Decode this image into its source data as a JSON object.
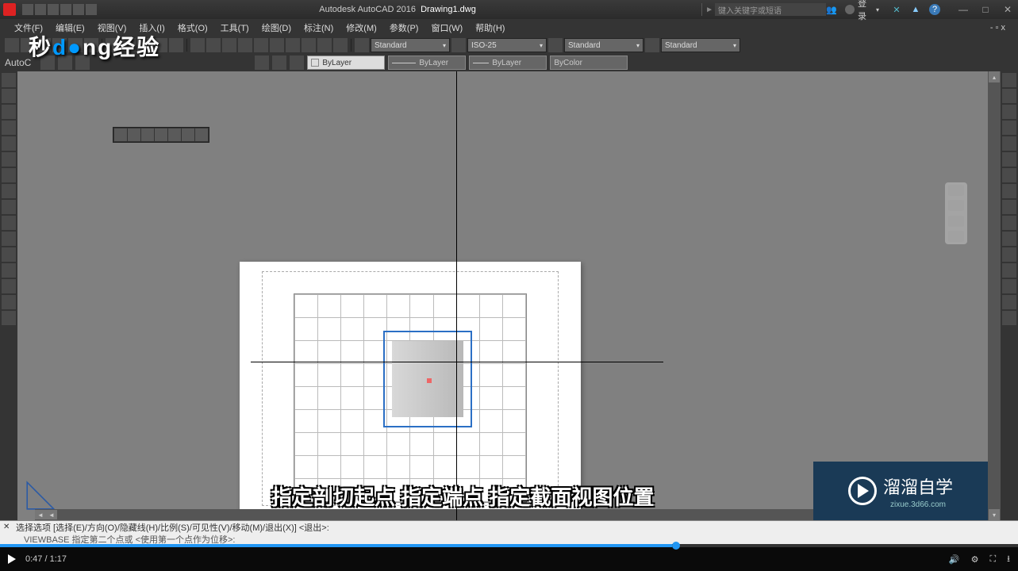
{
  "app": {
    "name": "Autodesk AutoCAD 2016",
    "doc": "Drawing1.dwg"
  },
  "search": {
    "placeholder": "键入关键字或短语"
  },
  "login": "登录",
  "menus": [
    "文件(F)",
    "编辑(E)",
    "视图(V)",
    "插入(I)",
    "格式(O)",
    "工具(T)",
    "绘图(D)",
    "标注(N)",
    "修改(M)",
    "参数(P)",
    "窗口(W)",
    "帮助(H)"
  ],
  "styles": {
    "text": "Standard",
    "dim": "ISO-25",
    "table": "Standard",
    "ml": "Standard"
  },
  "brand": "AutoC",
  "layer": {
    "color": "ByLayer",
    "ltype": "ByLayer",
    "lweight": "ByLayer",
    "plot": "ByColor"
  },
  "logo": {
    "p1": "秒",
    "p2": "d",
    "p3": "ng经验"
  },
  "subtitle": "指定剖切起点 指定端点 指定截面视图位置",
  "watermark": {
    "text": "溜溜自学",
    "url": "zixue.3d66.com"
  },
  "command": {
    "line1": "选择选项 [选择(E)/方向(O)/隐藏线(H)/比例(S)/可见性(V)/移动(M)/退出(X)] <退出>:",
    "line2": "VIEWBASE 指定第二个点或 <使用第一个点作为位移>:"
  },
  "player": {
    "current": "0:47",
    "total": "1:17",
    "progress_pct": 66
  }
}
